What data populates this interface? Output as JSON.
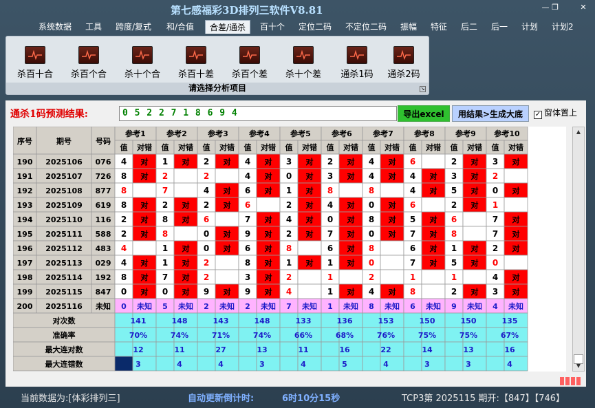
{
  "app": {
    "title": "第七感福彩3D排列三软件V8.81"
  },
  "window_controls": {
    "minimize": "—",
    "restore": "❐",
    "close": "✕"
  },
  "menu": [
    "系统数据",
    "工具",
    "跨度/复式",
    "和/合值",
    "合差/通杀",
    "百十个",
    "定位二码",
    "不定位二码",
    "振幅",
    "特征",
    "后二",
    "后一",
    "计划",
    "计划2"
  ],
  "menu_active_index": 4,
  "ribbon": {
    "buttons": [
      "杀百十合",
      "杀百个合",
      "杀十个合",
      "杀百十差",
      "杀百个差",
      "杀十个差",
      "通杀1码",
      "通杀2码"
    ],
    "caption": "请选择分析项目"
  },
  "prediction": {
    "label": "通杀1码预测结果:",
    "value": "0 5 2 2 7 1 8 6 9 4",
    "export_button": "导出excel",
    "generate_button": "用结果>生成大底",
    "pin_label": "窗体置上",
    "pin_checked": "✓"
  },
  "colors": {
    "red": "#ff0000",
    "header_bg": "#d4d0c8",
    "summary_bg": "#7ff2f2",
    "unknown_bg": "#ffb3ff",
    "blue_text": "#1c1cc8",
    "red_text": "#ff0000"
  },
  "table": {
    "col_seq": "序号",
    "col_period": "期号",
    "col_code": "号码",
    "groups": [
      "参考1",
      "参考2",
      "参考3",
      "参考4",
      "参考5",
      "参考6",
      "参考7",
      "参考8",
      "参考9",
      "参考10"
    ],
    "sub_val": "值",
    "sub_ok": "对错",
    "mark_ok": "对",
    "rows": [
      {
        "seq": "190",
        "period": "2025106",
        "code": "076",
        "vals": [
          "4",
          "1",
          "2",
          "4",
          "3",
          "2",
          "4",
          "6",
          "2",
          "3"
        ],
        "marks": [
          "对",
          "对",
          "对",
          "对",
          "对",
          "对",
          "对",
          "",
          "对",
          "对"
        ],
        "valred": [
          false,
          false,
          false,
          false,
          false,
          false,
          false,
          true,
          false,
          false
        ]
      },
      {
        "seq": "191",
        "period": "2025107",
        "code": "726",
        "vals": [
          "8",
          "2",
          "2",
          "4",
          "0",
          "3",
          "4",
          "4",
          "3",
          "2"
        ],
        "marks": [
          "对",
          "",
          "",
          "对",
          "对",
          "对",
          "对",
          "对",
          "对",
          ""
        ],
        "valred": [
          false,
          true,
          true,
          false,
          false,
          false,
          false,
          false,
          false,
          true
        ]
      },
      {
        "seq": "192",
        "period": "2025108",
        "code": "877",
        "vals": [
          "8",
          "7",
          "4",
          "6",
          "1",
          "8",
          "8",
          "4",
          "5",
          "0"
        ],
        "marks": [
          "",
          "",
          "对",
          "对",
          "对",
          "",
          "",
          "对",
          "对",
          "对"
        ],
        "valred": [
          true,
          true,
          false,
          false,
          false,
          true,
          true,
          false,
          false,
          false
        ]
      },
      {
        "seq": "193",
        "period": "2025109",
        "code": "619",
        "vals": [
          "8",
          "2",
          "2",
          "6",
          "2",
          "4",
          "0",
          "6",
          "2",
          "1"
        ],
        "marks": [
          "对",
          "对",
          "对",
          "",
          "对",
          "对",
          "对",
          "",
          "对",
          ""
        ],
        "valred": [
          false,
          false,
          false,
          true,
          false,
          false,
          false,
          true,
          false,
          true
        ]
      },
      {
        "seq": "194",
        "period": "2025110",
        "code": "116",
        "vals": [
          "2",
          "8",
          "6",
          "7",
          "4",
          "0",
          "8",
          "5",
          "6",
          "7"
        ],
        "marks": [
          "对",
          "对",
          "",
          "对",
          "对",
          "对",
          "对",
          "对",
          "",
          "对"
        ],
        "valred": [
          false,
          false,
          true,
          false,
          false,
          false,
          false,
          false,
          true,
          false
        ]
      },
      {
        "seq": "195",
        "period": "2025111",
        "code": "588",
        "vals": [
          "2",
          "8",
          "0",
          "9",
          "2",
          "7",
          "0",
          "7",
          "8",
          "7"
        ],
        "marks": [
          "对",
          "",
          "对",
          "对",
          "对",
          "对",
          "对",
          "对",
          "",
          "对"
        ],
        "valred": [
          false,
          true,
          false,
          false,
          false,
          false,
          false,
          false,
          true,
          false
        ]
      },
      {
        "seq": "196",
        "period": "2025112",
        "code": "483",
        "vals": [
          "4",
          "1",
          "0",
          "6",
          "8",
          "6",
          "8",
          "6",
          "1",
          "2"
        ],
        "marks": [
          "",
          "对",
          "对",
          "对",
          "",
          "对",
          "",
          "对",
          "对",
          "对"
        ],
        "valred": [
          true,
          false,
          false,
          false,
          true,
          false,
          true,
          false,
          false,
          false
        ]
      },
      {
        "seq": "197",
        "period": "2025113",
        "code": "029",
        "vals": [
          "4",
          "1",
          "2",
          "8",
          "1",
          "1",
          "0",
          "7",
          "5",
          "0"
        ],
        "marks": [
          "对",
          "对",
          "",
          "对",
          "对",
          "对",
          "",
          "对",
          "对",
          ""
        ],
        "valred": [
          false,
          false,
          true,
          false,
          false,
          false,
          true,
          false,
          false,
          true
        ]
      },
      {
        "seq": "198",
        "period": "2025114",
        "code": "192",
        "vals": [
          "8",
          "7",
          "2",
          "3",
          "2",
          "1",
          "2",
          "1",
          "1",
          "4"
        ],
        "marks": [
          "对",
          "对",
          "",
          "对",
          "",
          "",
          "",
          "",
          "",
          "对"
        ],
        "valred": [
          false,
          false,
          true,
          false,
          true,
          true,
          true,
          true,
          true,
          false
        ]
      },
      {
        "seq": "199",
        "period": "2025115",
        "code": "847",
        "vals": [
          "0",
          "0",
          "9",
          "9",
          "4",
          "1",
          "4",
          "8",
          "2",
          "3"
        ],
        "marks": [
          "对",
          "对",
          "对",
          "对",
          "",
          "对",
          "对",
          "",
          "对",
          "对"
        ],
        "valred": [
          false,
          false,
          false,
          false,
          true,
          false,
          false,
          true,
          false,
          false
        ]
      },
      {
        "seq": "200",
        "period": "2025116",
        "code": "未知",
        "vals": [
          "0",
          "5",
          "2",
          "2",
          "7",
          "1",
          "8",
          "6",
          "9",
          "4"
        ],
        "marks": [
          "未知",
          "未知",
          "未知",
          "未知",
          "未知",
          "未知",
          "未知",
          "未知",
          "未知",
          "未知"
        ],
        "valred": [
          false,
          false,
          false,
          false,
          false,
          false,
          false,
          false,
          false,
          false
        ]
      }
    ],
    "summary": [
      {
        "label": "对次数",
        "values": [
          "141",
          "148",
          "143",
          "148",
          "133",
          "136",
          "153",
          "150",
          "150",
          "135"
        ]
      },
      {
        "label": "准确率",
        "values": [
          "70%",
          "74%",
          "71%",
          "74%",
          "66%",
          "68%",
          "76%",
          "75%",
          "75%",
          "67%"
        ]
      },
      {
        "label": "最大连对数",
        "values": [
          "12",
          "11",
          "27",
          "13",
          "11",
          "16",
          "22",
          "14",
          "13",
          "16"
        ]
      },
      {
        "label": "最大连错数",
        "values": [
          "3",
          "4",
          "4",
          "3",
          "4",
          "5",
          "4",
          "3",
          "3",
          "4"
        ]
      }
    ]
  },
  "status": {
    "data_source": "当前数据为:[体彩排列三]",
    "countdown_label": "自动更新倒计时:",
    "countdown_value": "6时10分15秒",
    "draw_info": "TCP3第 2025115 期开:【847】【746】"
  }
}
